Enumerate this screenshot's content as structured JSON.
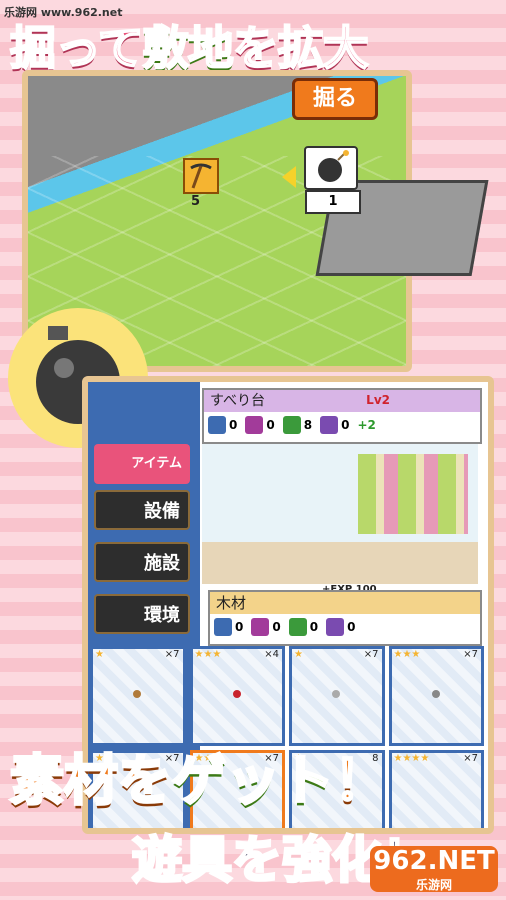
{
  "watermark": "乐游网 www.962.net",
  "headline": {
    "part1": "掘って",
    "part2": "敷地",
    "part3": "を",
    "part4": "拡大"
  },
  "map": {
    "dig_button": "掘る",
    "pickaxe_count": "5",
    "bomb_count": "1"
  },
  "panel": {
    "sidebar": {
      "items_label": "アイテム",
      "equipment": "設備",
      "facility": "施設",
      "environment": "環境"
    },
    "item_card": {
      "name": "すべり台",
      "level": "2",
      "stats": [
        {
          "icon": "blue",
          "value": "0"
        },
        {
          "icon": "purple",
          "value": "0"
        },
        {
          "icon": "green",
          "value": "8"
        },
        {
          "icon": "violet",
          "value": "0"
        }
      ],
      "bonus": "+2"
    },
    "exp_label": "+EXP",
    "exp_value": "100",
    "material": {
      "name": "木材",
      "stats": [
        {
          "icon": "blue",
          "value": "0"
        },
        {
          "icon": "purple",
          "value": "0"
        },
        {
          "icon": "green",
          "value": "0"
        },
        {
          "icon": "violet",
          "value": "0"
        }
      ]
    },
    "cards": [
      {
        "stars": "★",
        "qty": "×7"
      },
      {
        "stars": "★★★",
        "qty": "×4"
      },
      {
        "stars": "★",
        "qty": "×7"
      },
      {
        "stars": "★★★",
        "qty": "×7"
      },
      {
        "stars": "★★",
        "qty": "×7"
      },
      {
        "stars": "★★",
        "qty": "×7"
      },
      {
        "stars": "★",
        "qty": "8"
      },
      {
        "stars": "★★★★",
        "qty": "×7"
      }
    ]
  },
  "claim1": {
    "part1": "素材を",
    "part2": "ゲット",
    "part3": "！"
  },
  "claim2": {
    "part1": "遊具を",
    "part2": "強化",
    "part3": "！"
  },
  "logo": {
    "big": "962.NET",
    "small": "乐游网"
  },
  "colors": {
    "pink": "#e9537b",
    "green": "#7ec343",
    "orange": "#f07a1c",
    "blue": "#3d6bb1"
  }
}
